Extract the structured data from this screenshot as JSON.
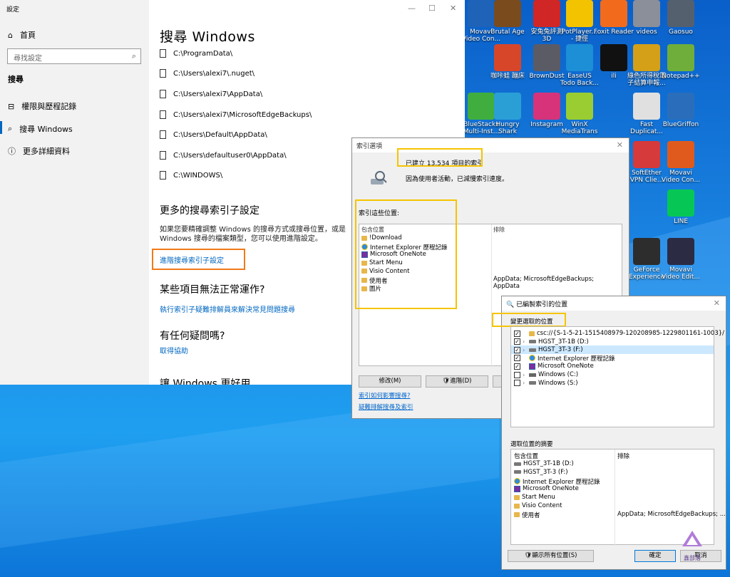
{
  "desktop": {
    "icons": [
      {
        "label": "Movavi\nVideo Con...",
        "icon": "movavi-icon",
        "color": "#1e63b8"
      },
      {
        "label": "Brutal Age",
        "icon": "brutal-age-icon",
        "color": "#7a4b1d"
      },
      {
        "label": "安兔兔評測\n3D",
        "icon": "antutu-icon",
        "color": "#d02626"
      },
      {
        "label": "PotPlayer...\n- 捷徑",
        "icon": "potplayer-icon",
        "color": "#f3c300"
      },
      {
        "label": "Foxit Reader",
        "icon": "foxit-reader-icon",
        "color": "#f26b1d"
      },
      {
        "label": "videos",
        "icon": "folder-icon",
        "color": "#8a8f99"
      },
      {
        "label": "Gaosuo",
        "icon": "gaosuo-icon",
        "color": "#55606e"
      },
      {
        "label": "咖咔蛙 蹦床",
        "icon": "game-icon",
        "color": "#d8462a"
      },
      {
        "label": "BrownDust",
        "icon": "browndust-icon",
        "color": "#5b5b66"
      },
      {
        "label": "EaseUS\nTodo Back...",
        "icon": "easeus-icon",
        "color": "#1c8fd6"
      },
      {
        "label": "ili",
        "icon": "ili-icon",
        "color": "#111111"
      },
      {
        "label": "綠色所得稅電\n子結算申報...",
        "icon": "tax-icon",
        "color": "#d4a017"
      },
      {
        "label": "Notepad++",
        "icon": "notepadpp-icon",
        "color": "#6fae3a"
      },
      {
        "label": "BlueStacks\nMulti-Inst...",
        "icon": "bluestacks-icon",
        "color": "#3fae3f"
      },
      {
        "label": "Hungry\nShark",
        "icon": "hungry-shark-icon",
        "color": "#2a9fd6"
      },
      {
        "label": "Instagram",
        "icon": "instagram-icon",
        "color": "#d6337a"
      },
      {
        "label": "WinX\nMediaTrans",
        "icon": "winx-icon",
        "color": "#9acd32"
      },
      {
        "label": "Fast\nDuplicat...",
        "icon": "fast-duplicate-icon",
        "color": "#e0e0e0"
      },
      {
        "label": "BlueGriffon",
        "icon": "bluegriffon-icon",
        "color": "#2a6ebb"
      },
      {
        "label": "SoftEther\nVPN Clie...",
        "icon": "softether-icon",
        "color": "#d63a3a"
      },
      {
        "label": "Movavi\nVideo Con...",
        "icon": "movavi-icon",
        "color": "#e05a1d"
      },
      {
        "label": "LINE",
        "icon": "line-icon",
        "color": "#06c755"
      },
      {
        "label": "GeForce\nExperience",
        "icon": "geforce-icon",
        "color": "#2d2d2d"
      },
      {
        "label": "Movavi\nVideo Edit...",
        "icon": "movavi-editor-icon",
        "color": "#2b2b44"
      }
    ]
  },
  "settings": {
    "app_title": "設定",
    "home": "首頁",
    "search_placeholder": "尋找設定",
    "section": "搜尋",
    "nav": [
      "權限與歷程記錄",
      "搜尋 Windows",
      "更多詳細資料"
    ],
    "page_title": "搜尋 Windows",
    "paths": [
      "C:\\ProgramData\\",
      "C:\\Users\\alexi7\\.nuget\\",
      "C:\\Users\\alexi7\\AppData\\",
      "C:\\Users\\alexi7\\MicrosoftEdgeBackups\\",
      "C:\\Users\\Default\\AppData\\",
      "C:\\Users\\defaultuser0\\AppData\\",
      "C:\\WINDOWS\\"
    ],
    "more_heading": "更多的搜尋索引子設定",
    "more_desc": "如果您要精確調整 Windows 的搜尋方式或搜尋位置，或是 Windows 搜尋的檔案類型，您可以使用進階設定。",
    "advanced_link": "進階搜尋索引子設定",
    "trouble_heading": "某些項目無法正常運作?",
    "trouble_link": "執行索引子疑難排解員來解決常見問題搜尋",
    "question_heading": "有任何疑問嗎?",
    "help_link": "取得協助",
    "better_heading": "讓 Windows 更好用"
  },
  "indexing": {
    "title": "索引選項",
    "count_text": "已建立 13,534 項目的索引",
    "status_text": "因為使用者活動，已減慢索引速度。",
    "locations_label": "索引這些位置:",
    "col_included": "包含位置",
    "col_excluded": "排除",
    "locations": [
      {
        "name": "!Download",
        "icon": "folder-icon"
      },
      {
        "name": "Internet Explorer 歷程記錄",
        "icon": "internet-explorer-icon"
      },
      {
        "name": "Microsoft OneNote",
        "icon": "onenote-icon"
      },
      {
        "name": "Start Menu",
        "icon": "folder-icon"
      },
      {
        "name": "Visio Content",
        "icon": "folder-icon"
      },
      {
        "name": "使用者",
        "icon": "folder-icon"
      },
      {
        "name": "圖片",
        "icon": "folder-icon"
      }
    ],
    "excluded_text": "AppData; MicrosoftEdgeBackups; AppData",
    "modify_button": "修改(M)",
    "advanced_button": "進階(D)",
    "link_affect": "索引如何影響搜尋?",
    "link_troubleshoot": "疑難排解搜尋及索引"
  },
  "indexed_locations": {
    "title": "已編製索引的位置",
    "change_label": "變更選取的位置",
    "tree": [
      {
        "label": "csc://{S-1-5-21-1515408979-120208985-1229801161-1003}/",
        "checked": true,
        "expand": false,
        "icon": "folder-icon",
        "selected": false
      },
      {
        "label": "HGST_3T-1B (D:)",
        "checked": true,
        "expand": true,
        "icon": "drive-icon",
        "selected": false
      },
      {
        "label": "HGST_3T-3 (F:)",
        "checked": true,
        "expand": true,
        "icon": "drive-icon",
        "selected": true
      },
      {
        "label": "Internet Explorer 歷程記錄",
        "checked": true,
        "expand": false,
        "icon": "internet-explorer-icon",
        "selected": false
      },
      {
        "label": "Microsoft OneNote",
        "checked": true,
        "expand": false,
        "icon": "onenote-icon",
        "selected": false
      },
      {
        "label": "Windows (C:)",
        "checked": false,
        "expand": true,
        "icon": "windows-drive-icon",
        "selected": false
      },
      {
        "label": "Windows (S:)",
        "checked": false,
        "expand": true,
        "icon": "drive-icon",
        "selected": false
      }
    ],
    "summary_label": "選取位置的摘要",
    "col_included": "包含位置",
    "col_excluded": "排除",
    "summary": [
      {
        "label": "HGST_3T-1B (D:)",
        "icon": "drive-icon"
      },
      {
        "label": "HGST_3T-3 (F:)",
        "icon": "drive-icon"
      },
      {
        "label": "Internet Explorer 歷程記錄",
        "icon": "internet-explorer-icon"
      },
      {
        "label": "Microsoft OneNote",
        "icon": "onenote-icon"
      },
      {
        "label": "Start Menu",
        "icon": "folder-icon"
      },
      {
        "label": "Visio Content",
        "icon": "folder-icon"
      },
      {
        "label": "使用者",
        "icon": "folder-icon"
      }
    ],
    "summary_excluded": "AppData; MicrosoftEdgeBackups; ...",
    "show_all_button": "顯示所有位置(S)",
    "ok_button": "確定",
    "cancel_button": "取消"
  },
  "watermark": "鑫部落"
}
